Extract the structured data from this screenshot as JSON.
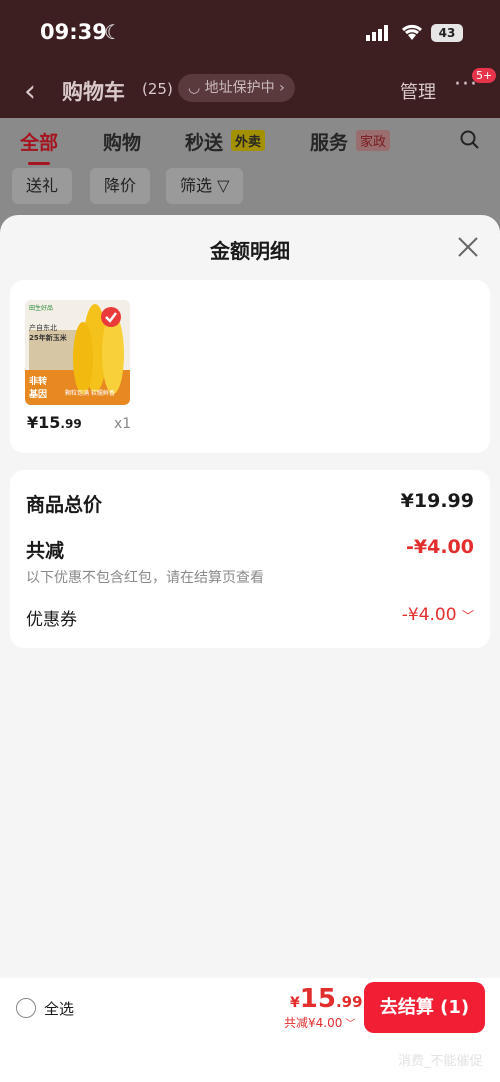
{
  "status_bar": {
    "time": "09:39",
    "battery": "43"
  },
  "navbar": {
    "title": "购物车",
    "count": "(25)",
    "address_protect": "地址保护中",
    "manage": "管理",
    "more_badge": "5+"
  },
  "tabs": [
    {
      "label": "全部"
    },
    {
      "label": "购物"
    },
    {
      "label": "秒送",
      "tag": "外卖"
    },
    {
      "label": "服务",
      "tag": "家政"
    }
  ],
  "filters": [
    "送礼",
    "降价",
    "筛选"
  ],
  "sheet": {
    "title": "金额明细",
    "product": {
      "image_text": [
        "产自东北",
        "25年新玉米",
        "非转",
        "基因",
        "颗粒饱满 软糯鲜香"
      ],
      "price_int": "¥15",
      "price_dec": ".99",
      "qty": "x1"
    },
    "summary": {
      "total_label": "商品总价",
      "total_value": "¥19.99",
      "discount_label": "共减",
      "discount_value": "-¥4.00",
      "note": "以下优惠不包含红包，请在结算页查看",
      "coupon_label": "优惠券",
      "coupon_value": "-¥4.00"
    }
  },
  "bottom_bar": {
    "select_all": "全选",
    "currency": "¥",
    "price_int": "15",
    "price_dec": ".99",
    "discount_summary": "共减¥4.00",
    "checkout": "去结算 (1)",
    "watermark": "消费_不能催促"
  },
  "colors": {
    "accent": "#f21e33",
    "price_red": "#e32e2e"
  }
}
